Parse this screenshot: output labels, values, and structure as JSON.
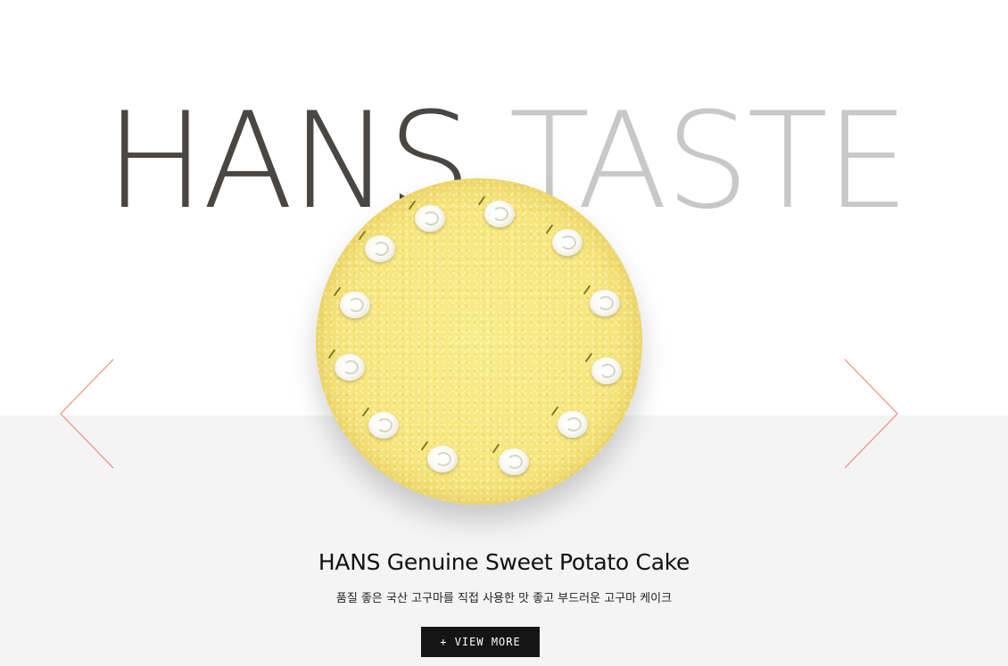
{
  "hero": {
    "title_part1": "HANS",
    "title_part2": "TASTE"
  },
  "slider": {
    "prev_icon": "chevron-left-icon",
    "next_icon": "chevron-right-icon",
    "arrow_color": "#f08c78"
  },
  "product": {
    "name": "HANS Genuine Sweet Potato Cake",
    "description": "품질 좋은 국산 고구마를 직접 사용한 맛 좋고 부드러운 고구마 케이크",
    "button_label": "+ VIEW MORE",
    "image_alt_icon": "cake-image"
  },
  "colors": {
    "title_dark": "#4a4643",
    "title_light": "#c8c8c8",
    "band": "#f4f4f4",
    "button": "#151515"
  }
}
